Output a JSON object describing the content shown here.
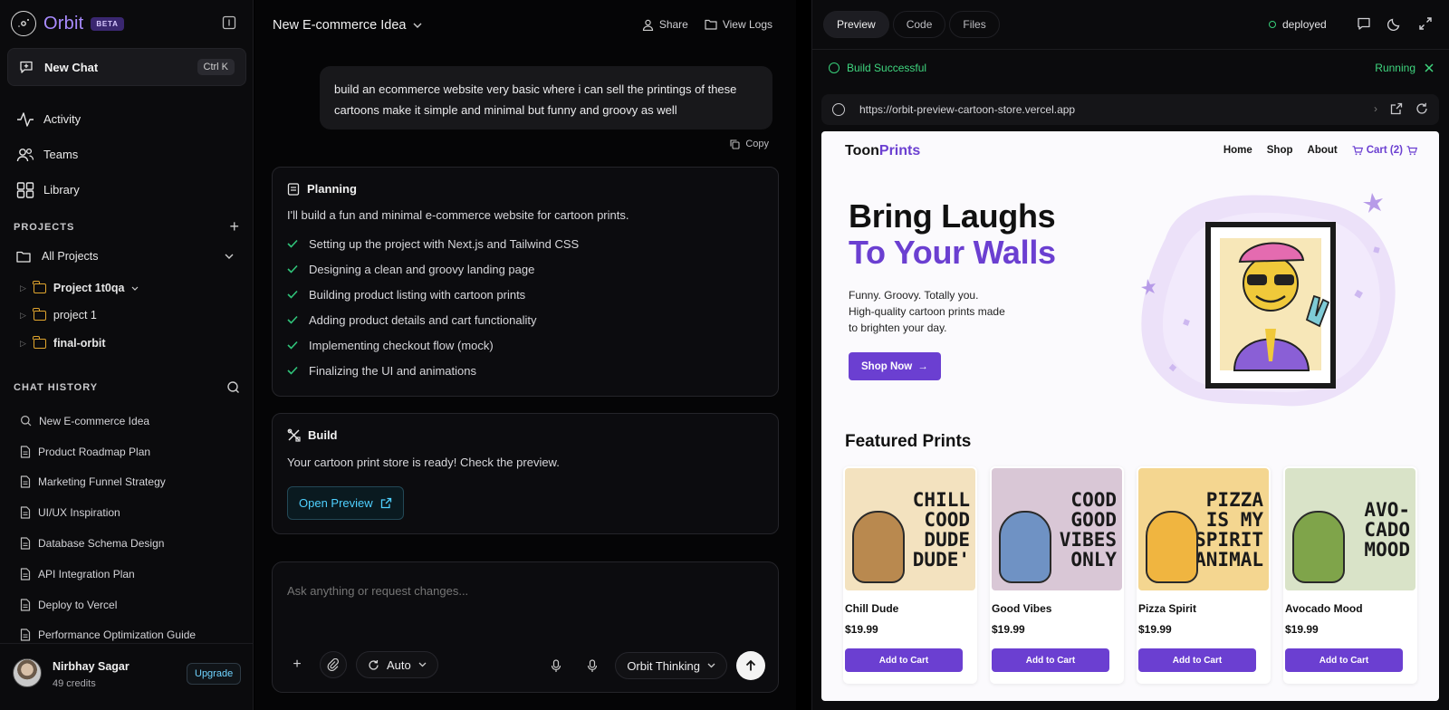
{
  "brand": {
    "name": "Orbit",
    "badge": "BETA"
  },
  "sidebar": {
    "new_chat": {
      "label": "New Chat",
      "shortcut": "Ctrl K"
    },
    "nav": [
      {
        "label": "Activity",
        "icon": "activity-icon"
      },
      {
        "label": "Teams",
        "icon": "teams-icon"
      },
      {
        "label": "Library",
        "icon": "library-icon"
      }
    ],
    "projects_header": "PROJECTS",
    "all_projects": "All Projects",
    "projects": [
      {
        "label": "Project 1t0qa"
      },
      {
        "label": "project 1"
      },
      {
        "label": "final-orbit"
      }
    ],
    "history_header": "CHAT HISTORY",
    "history": [
      {
        "label": "New E-commerce Idea",
        "icon": "search-icon"
      },
      {
        "label": "Product Roadmap Plan",
        "icon": "document-icon"
      },
      {
        "label": "Marketing Funnel Strategy",
        "icon": "document-icon"
      },
      {
        "label": "UI/UX Inspiration",
        "icon": "document-icon"
      },
      {
        "label": "Database Schema Design",
        "icon": "document-icon"
      },
      {
        "label": "API Integration Plan",
        "icon": "document-icon"
      },
      {
        "label": "Deploy to Vercel",
        "icon": "document-icon"
      },
      {
        "label": "Performance Optimization Guide",
        "icon": "document-icon"
      }
    ],
    "user": {
      "name": "Nirbhay Sagar",
      "credits": "49 credits",
      "upgrade": "Upgrade"
    }
  },
  "chat": {
    "title": "New E-commerce Idea",
    "actions": {
      "share": "Share",
      "logs": "View Logs"
    },
    "user_message": "build an ecommerce website very basic where i can sell the printings of these cartoons make it simple and minimal but funny and groovy as well",
    "copy": "Copy",
    "planning": {
      "title": "Planning",
      "intro": "I'll build a fun and minimal e-commerce website for cartoon prints.",
      "steps": [
        "Setting up the project with Next.js and Tailwind CSS",
        "Designing a clean and groovy landing page",
        "Building product listing with cartoon prints",
        "Adding product details and cart functionality",
        "Implementing checkout flow (mock)",
        "Finalizing the UI and animations"
      ]
    },
    "build": {
      "title": "Build",
      "text": "Your cartoon print store is ready! Check the preview.",
      "open_preview": "Open Preview"
    },
    "composer": {
      "placeholder": "Ask anything or request changes...",
      "mode": "Auto",
      "model": "Orbit Thinking"
    }
  },
  "panel": {
    "tabs": [
      "Preview",
      "Code",
      "Files"
    ],
    "active_tab": "Preview",
    "status": "deployed",
    "build_status": "Build Successful",
    "run_status": "Running",
    "url": "https://orbit-preview-cartoon-store.vercel.app"
  },
  "site": {
    "logo_a": "Toon",
    "logo_b": "Prints",
    "nav": [
      "Home",
      "Shop",
      "About"
    ],
    "cart": "Cart (2)",
    "hero_line1": "Bring Laughs",
    "hero_line2": "To Your Walls",
    "hero_sub": "Funny. Groovy. Totally you. High-quality cartoon prints made to brighten your day.",
    "shop_now": "Shop Now",
    "featured": "Featured Prints",
    "products": [
      {
        "name": "Chill Dude",
        "price": "$19.99",
        "caption_lines": [
          "CHILL",
          "COOD",
          "DUDE",
          "DUDE'"
        ],
        "bg": "#f3e2bf",
        "color": "#b9894f",
        "button": "Add to Cart"
      },
      {
        "name": "Good Vibes",
        "price": "$19.99",
        "caption_lines": [
          "COOD",
          "GOOD",
          "VIBES",
          "ONLY"
        ],
        "bg": "#d9c7d6",
        "color": "#6f92c4",
        "button": "Add to Cart"
      },
      {
        "name": "Pizza Spirit",
        "price": "$19.99",
        "caption_lines": [
          "PIZZA",
          "IS MY",
          "SPIRIT",
          "ANIMAL"
        ],
        "bg": "#f4d690",
        "color": "#f0b540",
        "button": "Add to Cart"
      },
      {
        "name": "Avocado Mood",
        "price": "$19.99",
        "caption_lines": [
          "AVO-",
          "CADO",
          "MOOD"
        ],
        "bg": "#d9e3c8",
        "color": "#7fa44a",
        "button": "Add to Cart"
      }
    ]
  }
}
